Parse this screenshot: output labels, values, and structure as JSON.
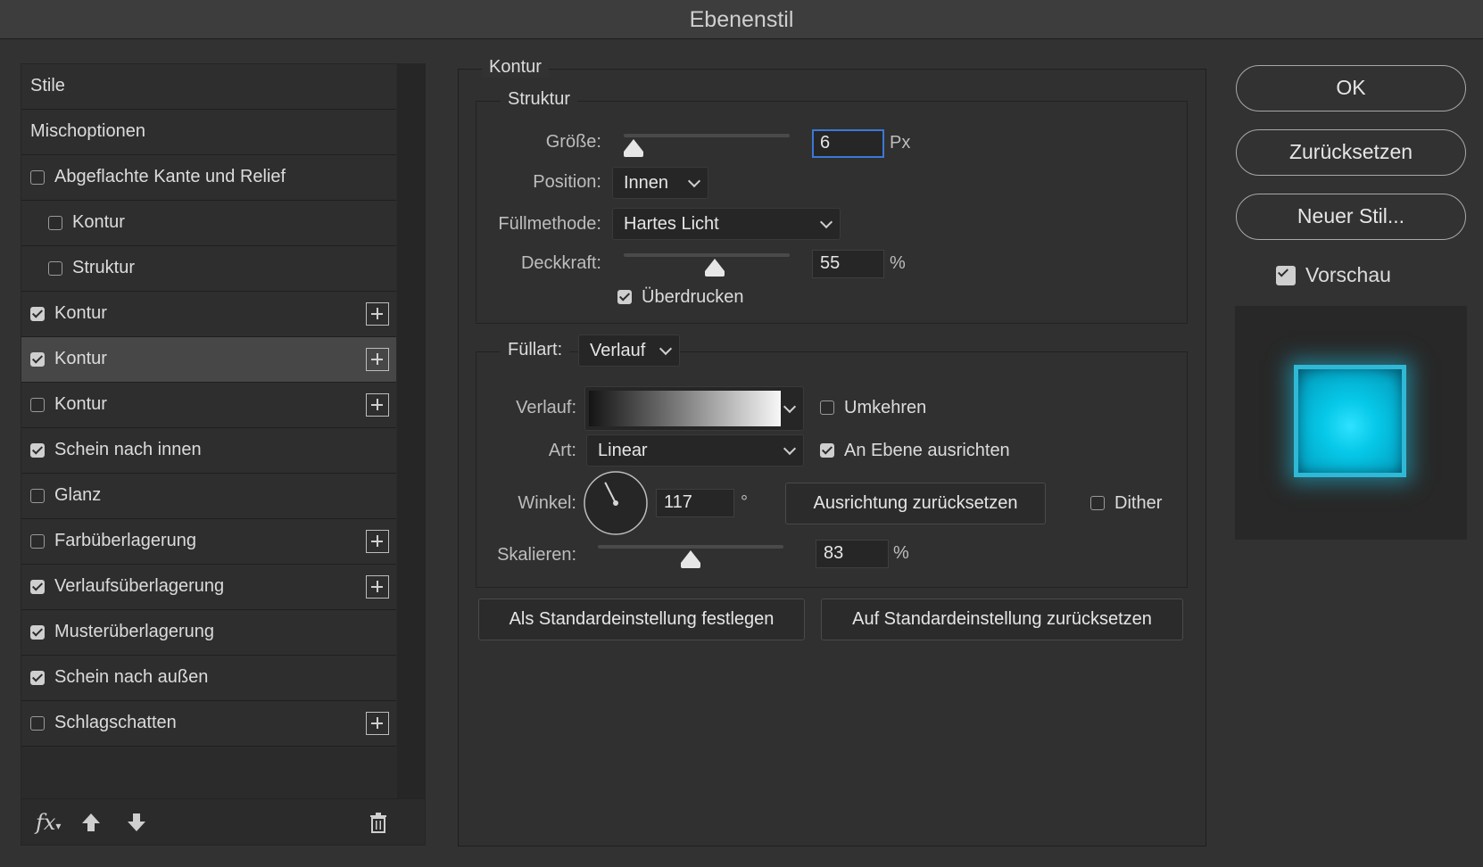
{
  "window": {
    "title": "Ebenenstil"
  },
  "styles_list": {
    "items": [
      {
        "label": "Stile",
        "checkbox": false,
        "checked": false,
        "plus": false,
        "indent": 0,
        "selected": false
      },
      {
        "label": "Mischoptionen",
        "checkbox": false,
        "checked": false,
        "plus": false,
        "indent": 0,
        "selected": false
      },
      {
        "label": "Abgeflachte Kante und Relief",
        "checkbox": true,
        "checked": false,
        "plus": false,
        "indent": 0,
        "selected": false
      },
      {
        "label": "Kontur",
        "checkbox": true,
        "checked": false,
        "plus": false,
        "indent": 1,
        "selected": false
      },
      {
        "label": "Struktur",
        "checkbox": true,
        "checked": false,
        "plus": false,
        "indent": 1,
        "selected": false
      },
      {
        "label": "Kontur",
        "checkbox": true,
        "checked": true,
        "plus": true,
        "indent": 0,
        "selected": false
      },
      {
        "label": "Kontur",
        "checkbox": true,
        "checked": true,
        "plus": true,
        "indent": 0,
        "selected": true
      },
      {
        "label": "Kontur",
        "checkbox": true,
        "checked": false,
        "plus": true,
        "indent": 0,
        "selected": false
      },
      {
        "label": "Schein nach innen",
        "checkbox": true,
        "checked": true,
        "plus": false,
        "indent": 0,
        "selected": false
      },
      {
        "label": "Glanz",
        "checkbox": true,
        "checked": false,
        "plus": false,
        "indent": 0,
        "selected": false
      },
      {
        "label": "Farbüberlagerung",
        "checkbox": true,
        "checked": false,
        "plus": true,
        "indent": 0,
        "selected": false
      },
      {
        "label": "Verlaufsüberlagerung",
        "checkbox": true,
        "checked": true,
        "plus": true,
        "indent": 0,
        "selected": false
      },
      {
        "label": "Musterüberlagerung",
        "checkbox": true,
        "checked": true,
        "plus": false,
        "indent": 0,
        "selected": false
      },
      {
        "label": "Schein nach außen",
        "checkbox": true,
        "checked": true,
        "plus": false,
        "indent": 0,
        "selected": false
      },
      {
        "label": "Schlagschatten",
        "checkbox": true,
        "checked": false,
        "plus": true,
        "indent": 0,
        "selected": false
      }
    ],
    "footer": {
      "fx_label": "fx"
    }
  },
  "contour": {
    "section_title": "Kontur",
    "structure_title": "Struktur",
    "size": {
      "label": "Größe:",
      "value": "6",
      "unit": "Px",
      "level": 0.03
    },
    "position": {
      "label": "Position:",
      "value": "Innen"
    },
    "blend_mode": {
      "label": "Füllmethode:",
      "value": "Hartes Licht"
    },
    "opacity": {
      "label": "Deckkraft:",
      "value": "55",
      "unit": "%",
      "level": 0.55
    },
    "overprint": {
      "label": "Überdrucken",
      "checked": true
    },
    "fill_type": {
      "label": "Füllart:",
      "value": "Verlauf"
    },
    "gradient": {
      "label": "Verlauf:"
    },
    "reverse": {
      "label": "Umkehren",
      "checked": false
    },
    "style": {
      "label": "Art:",
      "value": "Linear"
    },
    "align_layer": {
      "label": "An Ebene ausrichten",
      "checked": true
    },
    "angle": {
      "label": "Winkel:",
      "value": "117",
      "unit": "°",
      "degrees": 117
    },
    "reset_alignment": "Ausrichtung zurücksetzen",
    "dither": {
      "label": "Dither",
      "checked": false
    },
    "scale": {
      "label": "Skalieren:",
      "value": "83",
      "unit": "%",
      "level": 0.5
    },
    "make_default": "Als Standardeinstellung festlegen",
    "reset_default": "Auf Standardeinstellung zurücksetzen"
  },
  "actions": {
    "ok": "OK",
    "reset": "Zurücksetzen",
    "new_style": "Neuer Stil...",
    "preview": {
      "label": "Vorschau",
      "checked": true
    }
  }
}
